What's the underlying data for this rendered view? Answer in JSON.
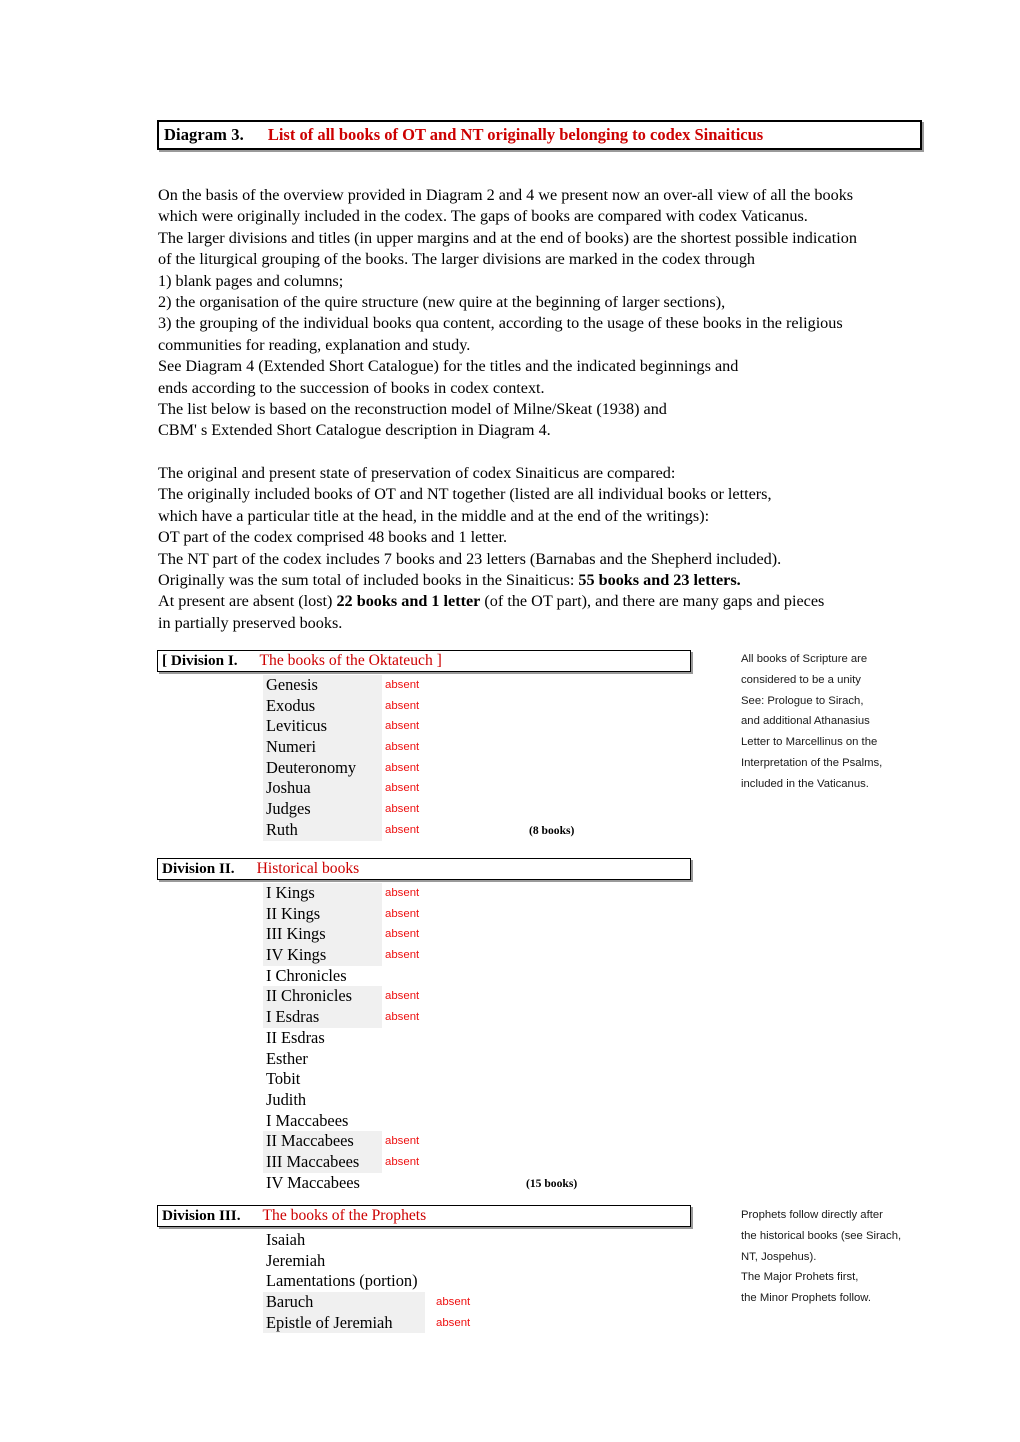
{
  "title_bar": {
    "label": "Diagram 3.",
    "title": "List of all books of OT and NT originally belonging to codex Sinaiticus",
    "accent_color": "#cc0000"
  },
  "intro": {
    "lines": [
      "On the basis of the overview provided in Diagram 2 and 4 we present now an over-all view of all the books",
      "which were originally included in the codex. The gaps of books are compared with codex Vaticanus.",
      "The larger divisions and titles (in upper margins and at the end of books) are the shortest possible indication",
      "of the liturgical grouping of the books. The larger divisions are marked in the codex through",
      "1) blank pages and columns;",
      "2) the organisation of the quire structure (new quire at the beginning of larger sections),",
      "3) the grouping of the individual books qua content, according to the usage of these books in the religious",
      "communities for reading, explanation and study.",
      "See Diagram 4 (Extended Short Catalogue) for the titles and the indicated beginnings and",
      "ends according to the succession of books in codex context.",
      "The list below is based on the reconstruction model of Milne/Skeat (1938) and",
      "CBM' s Extended Short Catalogue description in Diagram 4."
    ],
    "lines2_pre": [
      "The original and present state of preservation of codex Sinaiticus are compared:",
      "The originally included books of OT and NT together (listed are all individual books or letters,",
      "which have a particular title at the head, in the middle and at the end of the writings):",
      "OT part of the codex comprised 48 books and 1 letter.",
      "The NT part of the codex includes 7 books and 23 letters (Barnabas and the Shepherd included)."
    ],
    "total_line": {
      "prefix": "Originally was the sum total of included books in the Sinaiticus: ",
      "bold": "55 books and 23 letters.",
      "suffix": ""
    },
    "absent_line": {
      "prefix": "At present are absent (lost) ",
      "bold": "22 books and 1 letter",
      "suffix": " (of the OT part), and there are many gaps and pieces"
    },
    "last_line": "in partially preserved books."
  },
  "divisions": [
    {
      "id": "division-1",
      "number": "[ Division I.",
      "name": "The books of the Oktateuch ]",
      "count_label": "(8 books)",
      "books": [
        {
          "name": "Genesis",
          "absent": "absent"
        },
        {
          "name": "Exodus",
          "absent": "absent"
        },
        {
          "name": "Leviticus",
          "absent": "absent"
        },
        {
          "name": "Numeri",
          "absent": "absent"
        },
        {
          "name": "Deuteronomy",
          "absent": "absent"
        },
        {
          "name": "Joshua",
          "absent": "absent"
        },
        {
          "name": "Judges",
          "absent": "absent"
        },
        {
          "name": "Ruth",
          "absent": "absent"
        }
      ],
      "margin_note": [
        "All books of Scripture are",
        "considered to be a unity",
        "See: Prologue to Sirach,",
        "and additional Athanasius",
        "Letter to Marcellinus on the",
        "Interpretation of the Psalms,",
        "included in the Vaticanus."
      ]
    },
    {
      "id": "division-2",
      "number": "Division II.",
      "name": "Historical books",
      "count_label": "(15 books)",
      "books": [
        {
          "name": "I Kings",
          "absent": "absent"
        },
        {
          "name": "II Kings",
          "absent": "absent"
        },
        {
          "name": "III Kings",
          "absent": "absent"
        },
        {
          "name": "IV Kings",
          "absent": "absent"
        },
        {
          "name": "I Chronicles",
          "absent": ""
        },
        {
          "name": "II Chronicles",
          "absent": "absent"
        },
        {
          "name": "I Esdras",
          "absent": "absent"
        },
        {
          "name": "II Esdras",
          "absent": ""
        },
        {
          "name": "Esther",
          "absent": ""
        },
        {
          "name": "Tobit",
          "absent": ""
        },
        {
          "name": "Judith",
          "absent": ""
        },
        {
          "name": "I Maccabees",
          "absent": ""
        },
        {
          "name": "II Maccabees",
          "absent": "absent"
        },
        {
          "name": "III Maccabees",
          "absent": "absent"
        },
        {
          "name": "IV Maccabees",
          "absent": ""
        }
      ],
      "margin_note": []
    },
    {
      "id": "division-3",
      "number": "Division III.",
      "name": "The books of the Prophets",
      "count_label": "",
      "books": [
        {
          "name": "Isaiah",
          "absent": ""
        },
        {
          "name": "Jeremiah",
          "absent": ""
        },
        {
          "name": "Lamentations (portion)",
          "absent": ""
        },
        {
          "name": "Baruch",
          "absent": "absent"
        },
        {
          "name": "Epistle of Jeremiah",
          "absent": "absent"
        }
      ],
      "margin_note": [
        "Prophets follow directly after",
        "the historical books (see Sirach,",
        "NT, Jospehus).",
        "The Major Prohets first,",
        "the Minor Prophets follow."
      ]
    }
  ]
}
